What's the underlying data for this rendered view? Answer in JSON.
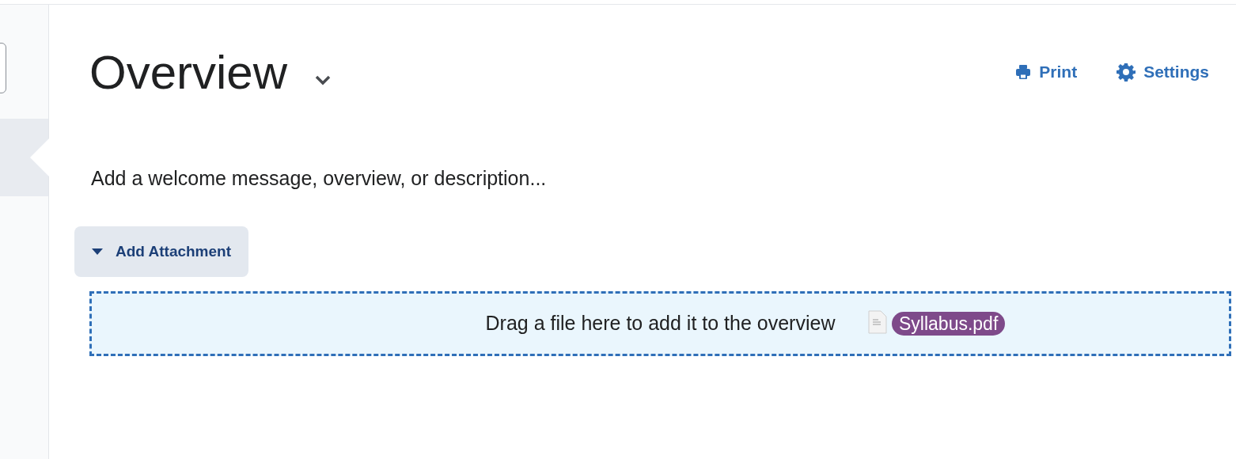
{
  "header": {
    "title": "Overview",
    "actions": [
      {
        "kind": "print",
        "label": "Print"
      },
      {
        "kind": "settings",
        "label": "Settings"
      }
    ]
  },
  "sidebar": {
    "items": [
      {
        "selected": true
      }
    ]
  },
  "description_field": {
    "placeholder": "Add a welcome message, overview, or description..."
  },
  "attachment_button": {
    "label": "Add Attachment",
    "expanded": true
  },
  "drop_zone": {
    "text": "Drag a file here to add it to the overview"
  },
  "dragged_file": {
    "name": "Syllabus.pdf"
  }
}
